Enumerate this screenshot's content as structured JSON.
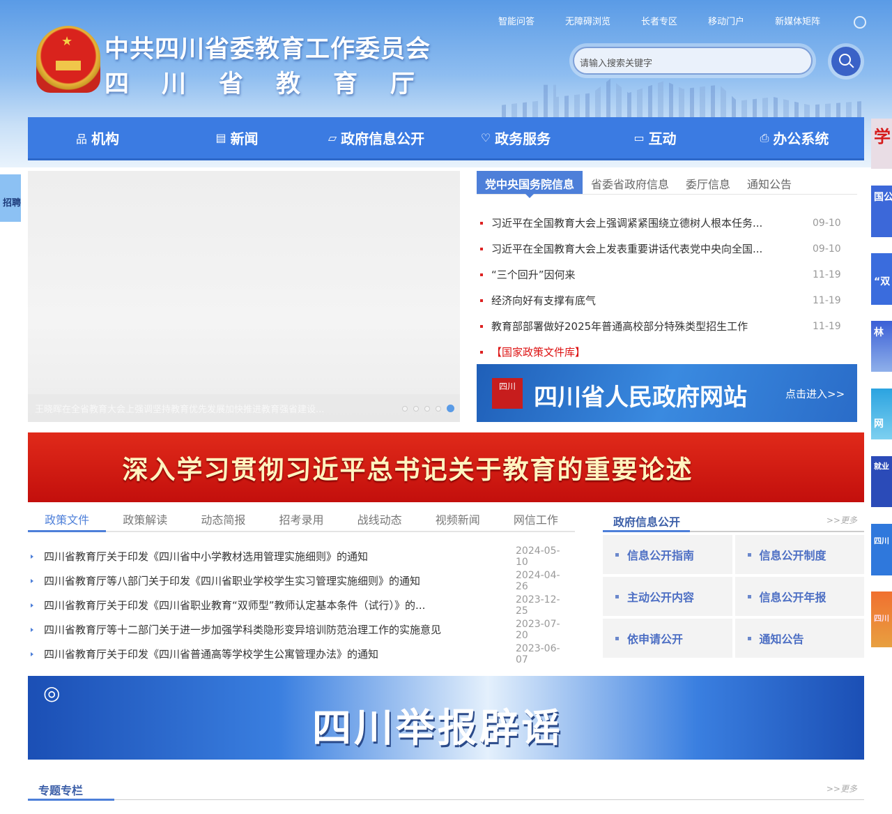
{
  "header": {
    "title_line1": "中共四川省委教育工作委员会",
    "title_line2": [
      "四",
      "川",
      "省",
      "教",
      "育",
      "厅"
    ],
    "top_links": [
      "智能问答",
      "无障碍浏览",
      "长者专区",
      "移动门户",
      "新媒体矩阵"
    ],
    "search_placeholder": "请输入搜索关键字"
  },
  "nav": [
    "机构",
    "新闻",
    "政府信息公开",
    "政务服务",
    "互动",
    "办公系统"
  ],
  "slider": {
    "caption": "王晓晖在全省教育大会上强调坚持教育优先发展加快推进教育强省建设...",
    "slide_count": 5,
    "active_slide": 5
  },
  "news": {
    "tabs": [
      "党中央国务院信息",
      "省委省政府信息",
      "委厅信息",
      "通知公告"
    ],
    "items": [
      {
        "title": "习近平在全国教育大会上强调紧紧围绕立德树人根本任务...",
        "date": "09-10"
      },
      {
        "title": "习近平在全国教育大会上发表重要讲话代表党中央向全国...",
        "date": "09-10"
      },
      {
        "title": " “三个回升”因何来",
        "date": "11-19"
      },
      {
        "title": "经济向好有支撑有底气",
        "date": "11-19"
      },
      {
        "title": "教育部部署做好2025年普通高校部分特殊类型招生工作",
        "date": "11-19"
      }
    ],
    "library": "【国家政策文件库】"
  },
  "gov_site": {
    "name": "四川省人民政府网站",
    "enter": "点击进入>>",
    "seal": "四川"
  },
  "red_banner": "深入学习贯彻习近平总书记关于教育的重要论述",
  "policy": {
    "tabs": [
      "政策文件",
      "政策解读",
      "动态简报",
      "招考录用",
      "战线动态",
      "视频新闻",
      "网信工作"
    ],
    "items": [
      {
        "title": "四川省教育厅关于印发《四川省中小学教材选用管理实施细则》的通知",
        "date": "2024-05-10"
      },
      {
        "title": "四川省教育厅等八部门关于印发《四川省职业学校学生实习管理实施细则》的通知",
        "date": "2024-04-26"
      },
      {
        "title": "四川省教育厅关于印发《四川省职业教育“双师型”教师认定基本条件（试行）》的...",
        "date": "2023-12-25"
      },
      {
        "title": "四川省教育厅等十二部门关于进一步加强学科类隐形变异培训防范治理工作的实施意见",
        "date": "2023-07-20"
      },
      {
        "title": "四川省教育厅关于印发《四川省普通高等学校学生公寓管理办法》的通知",
        "date": "2023-06-07"
      }
    ]
  },
  "gov_info": {
    "title": "政府信息公开",
    "more": ">>更多",
    "items": [
      "信息公开指南",
      "信息公开制度",
      "主动公开内容",
      "信息公开年报",
      "依申请公开",
      "通知公告"
    ]
  },
  "report_banner": "四川举报辟谣",
  "special": {
    "title": "专题专栏",
    "more": ">>更多"
  },
  "float_left": "招聘",
  "float_right": [
    "学",
    "国公",
    "“双",
    "林",
    "网",
    "就业",
    "四川",
    "四川"
  ],
  "colors": {
    "primary": "#3b7be2",
    "accent_red": "#d11",
    "link_blue": "#4d7fd9"
  }
}
